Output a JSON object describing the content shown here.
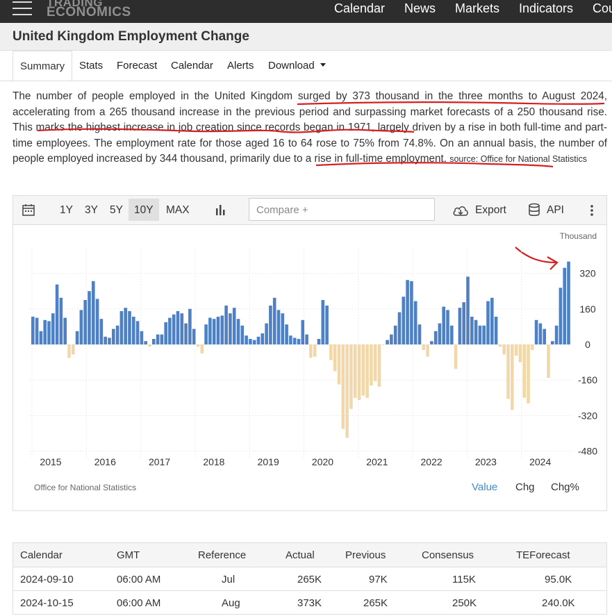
{
  "header": {
    "logo_line1": "TRADING",
    "logo_line2": "ECONOMICS",
    "nav": [
      "Calendar",
      "News",
      "Markets",
      "Indicators",
      "Cou"
    ]
  },
  "page": {
    "title": "United Kingdom Employment Change"
  },
  "tabs": {
    "summary": "Summary",
    "stats": "Stats",
    "forecast": "Forecast",
    "calendar": "Calendar",
    "alerts": "Alerts",
    "download": "Download"
  },
  "summary": {
    "p1": "The number of people employed in the United Kingdom ",
    "h1": "surged by 373 thousand in the three months to August 2024",
    "p2": ", accelerating from a 265 thousand increase in the previous period and surpassing market forecasts of a 250 thousand rise. ",
    "h2": "This marks the highest increase in job creation since records began in 1971",
    "p3": ", largely driven by a rise in both full-time and part-time employees. The employment rate for those aged 16 to 64 rose to 75% from 74.8%. On an annual basis, the number of people employed increased by 344 thousand, ",
    "h3": "primarily due to a rise in full-time employment",
    "p4": ".",
    "source": "source: Office for National Statistics"
  },
  "chart_toolbar": {
    "ranges": [
      "1Y",
      "3Y",
      "5Y",
      "10Y",
      "MAX"
    ],
    "selected_range": "10Y",
    "compare_placeholder": "Compare +",
    "export": "Export",
    "api": "API"
  },
  "chart_footer": {
    "source": "Office for National Statistics",
    "value": "Value",
    "chg": "Chg",
    "chgpct": "Chg%"
  },
  "chart_data": {
    "type": "bar",
    "unit_label": "Thousand",
    "yticks": [
      320,
      160,
      0,
      -160,
      -320,
      -480
    ],
    "ylim": [
      -480,
      370
    ],
    "xticks": [
      "2015",
      "2016",
      "2017",
      "2018",
      "2019",
      "2020",
      "2021",
      "2022",
      "2023",
      "2024"
    ],
    "start_year": 2014.95,
    "step_years": 0.0833,
    "positive_color": "#4d80c4",
    "negative_color": "#f2d8a8",
    "values": [
      125,
      120,
      60,
      110,
      105,
      140,
      270,
      210,
      120,
      -60,
      -45,
      60,
      155,
      200,
      240,
      285,
      205,
      115,
      35,
      30,
      70,
      85,
      150,
      165,
      150,
      125,
      105,
      60,
      15,
      -10,
      25,
      45,
      45,
      100,
      120,
      135,
      150,
      140,
      95,
      160,
      70,
      -10,
      -40,
      90,
      120,
      115,
      125,
      130,
      175,
      140,
      165,
      115,
      85,
      40,
      25,
      20,
      35,
      50,
      95,
      175,
      210,
      155,
      140,
      90,
      40,
      30,
      25,
      110,
      45,
      -60,
      -55,
      25,
      200,
      175,
      -70,
      -120,
      -180,
      -380,
      -420,
      -290,
      -240,
      -250,
      -230,
      -240,
      -185,
      -165,
      -190,
      -2,
      20,
      45,
      85,
      145,
      215,
      290,
      285,
      195,
      90,
      -25,
      -55,
      15,
      60,
      95,
      170,
      155,
      85,
      -110,
      165,
      190,
      305,
      125,
      110,
      85,
      85,
      195,
      210,
      125,
      -10,
      -45,
      -245,
      -295,
      -50,
      -80,
      -240,
      -265,
      -25,
      110,
      95,
      70,
      -150,
      15,
      85,
      255,
      345,
      373
    ]
  },
  "calendar": {
    "headers": [
      "Calendar",
      "GMT",
      "Reference",
      "Actual",
      "Previous",
      "Consensus",
      "TEForecast"
    ],
    "rows": [
      [
        "2024-09-10",
        "06:00 AM",
        "Jul",
        "265K",
        "97K",
        "115K",
        "95.0K"
      ],
      [
        "2024-10-15",
        "06:00 AM",
        "Aug",
        "373K",
        "265K",
        "250K",
        "240.0K"
      ]
    ]
  }
}
